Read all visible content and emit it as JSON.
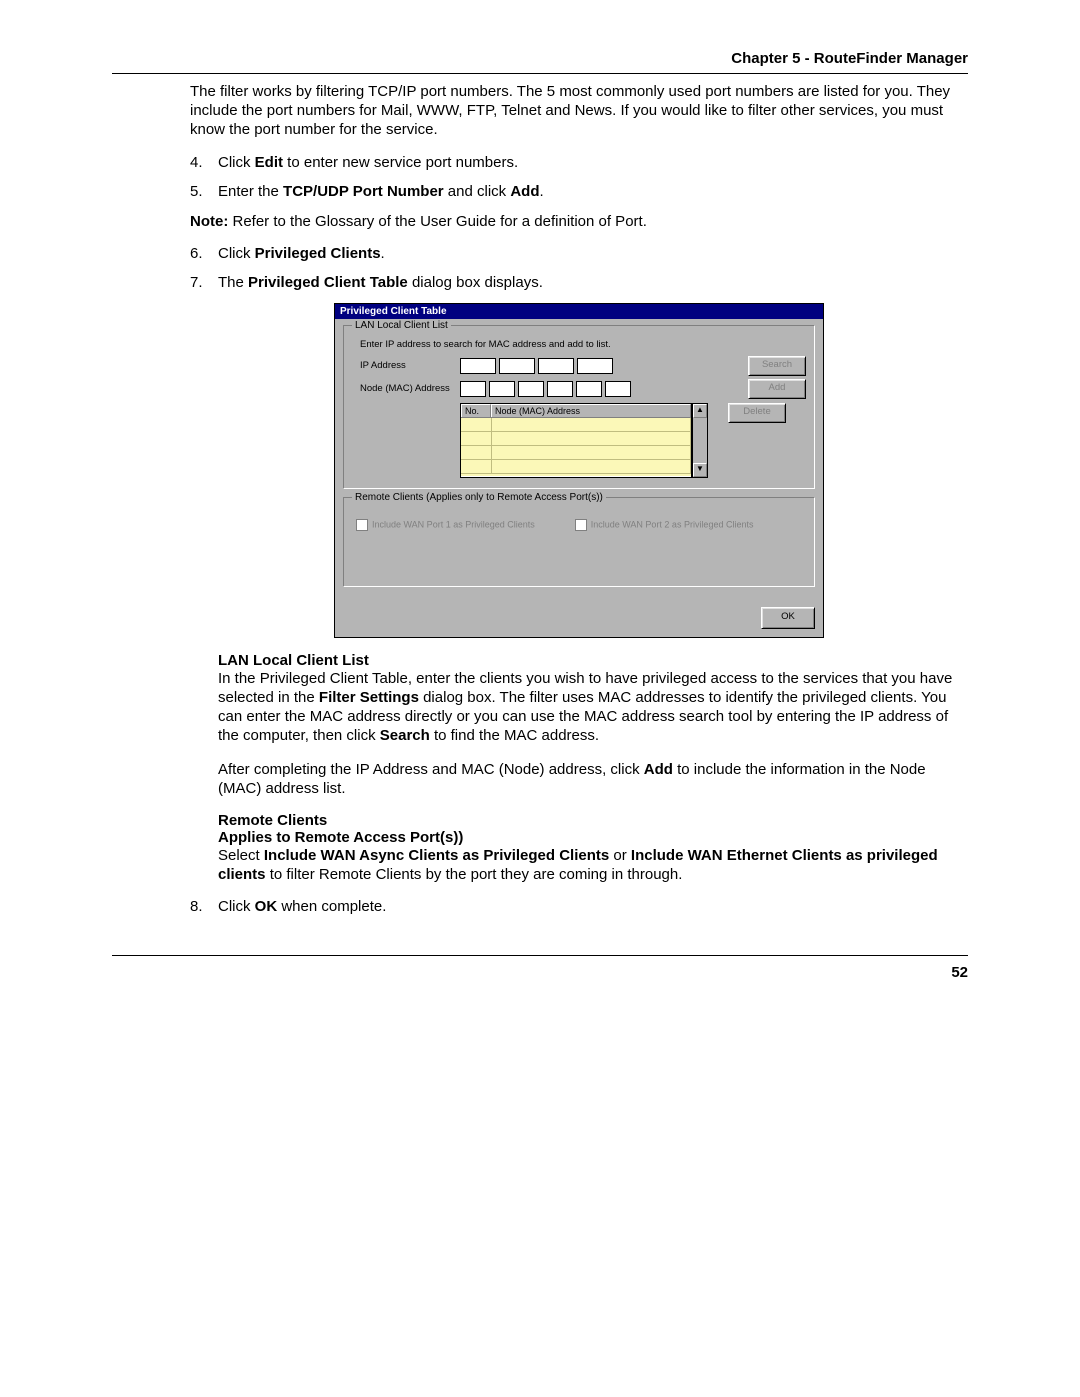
{
  "header": "Chapter 5 - RouteFinder Manager",
  "page_number": "52",
  "intro_para": "The filter works by filtering TCP/IP port numbers.  The 5 most commonly used port numbers are listed for you.  They include the port numbers for Mail, WWW, FTP, Telnet and News.  If you would like to filter other services, you must know the port number for the service.",
  "steps": {
    "s4": {
      "num": "4.",
      "pre": "Click ",
      "b": "Edit",
      "post": " to enter new service port numbers."
    },
    "s5": {
      "num": "5.",
      "pre": "Enter the ",
      "b": "TCP/UDP Port Number",
      "mid": " and click ",
      "b2": "Add",
      "post": "."
    },
    "note": {
      "b": "Note:",
      "post": " Refer to the Glossary of the User Guide for a definition of Port."
    },
    "s6": {
      "num": "6.",
      "pre": "Click ",
      "b": "Privileged Clients",
      "post": "."
    },
    "s7": {
      "num": "7.",
      "pre": "The ",
      "b": "Privileged Client Table",
      "post": " dialog box displays."
    },
    "s8": {
      "num": "8.",
      "pre": "Click ",
      "b": "OK",
      "post": " when complete."
    }
  },
  "dialog": {
    "title": "Privileged Client Table",
    "group1_title": "LAN Local Client List",
    "hint": "Enter IP address to search for MAC address and add to list.",
    "lbl_ip": "IP Address",
    "lbl_mac": "Node (MAC) Address",
    "btn_search": "Search",
    "btn_add": "Add",
    "btn_delete": "Delete",
    "col_no": "No.",
    "col_mac": "Node (MAC) Address",
    "group2_title": "Remote Clients (Applies only to Remote Access Port(s))",
    "chk1": "Include WAN Port 1 as Privileged Clients",
    "chk2": "Include WAN Port 2 as Privileged Clients",
    "btn_ok": "OK"
  },
  "lan_section": {
    "title": "LAN Local Client List",
    "p1a": "In the Privileged Client Table, enter the clients you wish to have privileged access to the services that you have selected in the ",
    "p1b": "Filter Settings",
    "p1c": " dialog box.  The filter uses MAC addresses to identify the privileged clients.  You can enter the MAC address directly or you can use the MAC address search tool by entering the IP address of the computer, then click ",
    "p1d": "Search",
    "p1e": " to find the MAC address.",
    "p2a": "After completing the IP Address and MAC (Node) address, click ",
    "p2b": "Add",
    "p2c": " to include the information in the Node (MAC) address list."
  },
  "remote_section": {
    "title1": "Remote Clients",
    "title2": "Applies to Remote Access Port(s))",
    "p1a": "Select ",
    "p1b": "Include WAN Async Clients as Privileged Clients",
    "p1c": " or ",
    "p1d": "Include WAN Ethernet Clients as privileged clients",
    "p1e": " to filter Remote Clients by the port they are coming in through."
  }
}
